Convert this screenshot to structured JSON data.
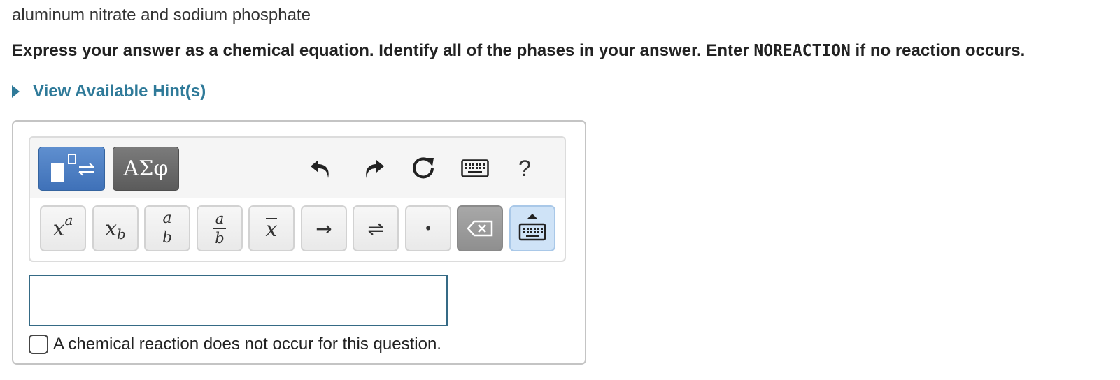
{
  "question": "aluminum nitrate and sodium phosphate",
  "instruction": {
    "before": "Express your answer as a chemical equation. Identify all of the phases in your answer. Enter ",
    "code": "NOREACTION",
    "after": " if no reaction occurs."
  },
  "hint": {
    "label": "View Available Hint(s)"
  },
  "toolbar": {
    "greek_label": "ΑΣφ",
    "help_label": "?",
    "keys": {
      "superscript_base": "x",
      "superscript_exp": "a",
      "subscript_base": "x",
      "subscript_sub": "b",
      "frac_num": "a",
      "frac_den": "b",
      "small_frac_num": "a",
      "small_frac_den": "b",
      "overline_var": "x",
      "arrow": "→",
      "equilibrium": "⇌",
      "dot": "•"
    }
  },
  "answer": {
    "value": ""
  },
  "no_reaction": {
    "label": "A chemical reaction does not occur for this question.",
    "checked": false
  },
  "colors": {
    "link": "#2f7a99",
    "templates_btn": "#4a7cc1",
    "greek_btn": "#676767",
    "input_border": "#356a85",
    "keyboard_key": "#cfe3f7"
  }
}
